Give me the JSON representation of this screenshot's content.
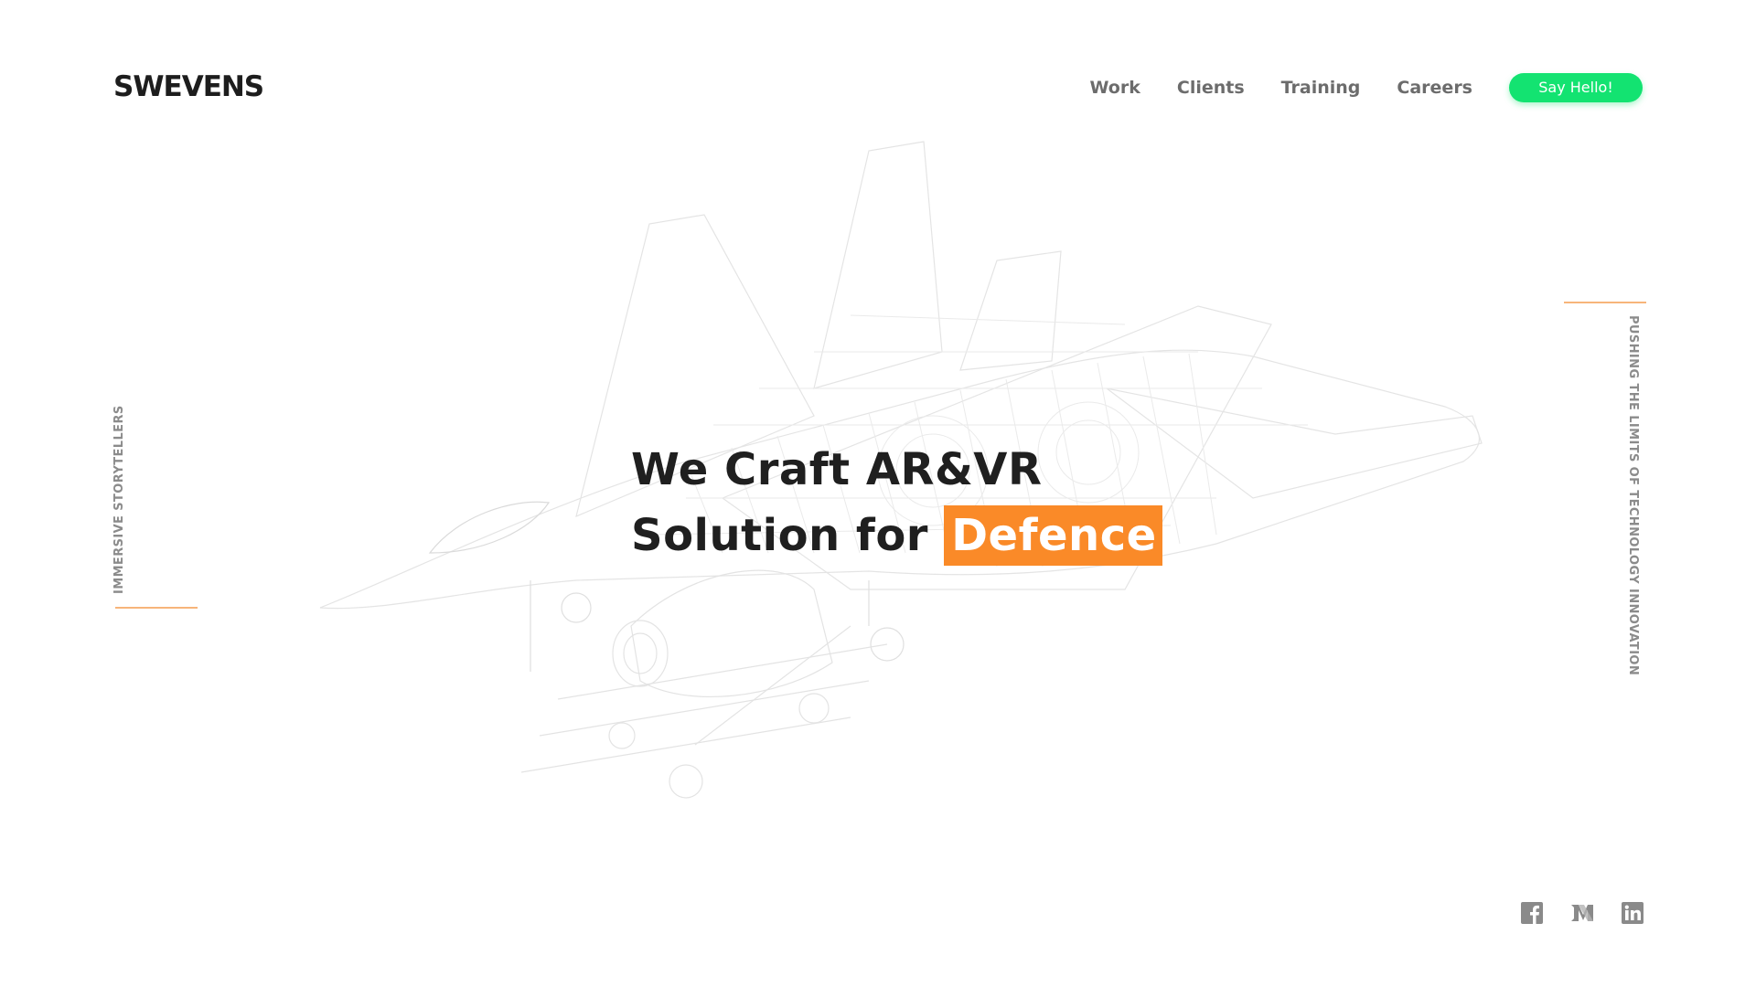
{
  "brand": {
    "logo_text": "SWEVENS"
  },
  "nav": {
    "items": [
      {
        "label": "Work"
      },
      {
        "label": "Clients"
      },
      {
        "label": "Training"
      },
      {
        "label": "Careers"
      }
    ],
    "cta_label": "Say Hello!"
  },
  "side": {
    "left_label": "IMMERSIVE STORYTELLERS",
    "right_label": "PUSHING THE LIMITS OF TECHNOLOGY INNOVATION"
  },
  "hero": {
    "line1": "We Craft AR&VR",
    "line2_prefix": "Solution for",
    "highlight": "Defence"
  },
  "social": {
    "icons": [
      "facebook-icon",
      "medium-icon",
      "linkedin-icon"
    ]
  },
  "colors": {
    "accent_orange": "#fa8a28",
    "cta_green": "#13e371",
    "text_dark": "#1f1f1f",
    "nav_gray": "#6c6c6c",
    "icon_gray": "#8a8a8a",
    "line_orange": "#f7b57a"
  }
}
